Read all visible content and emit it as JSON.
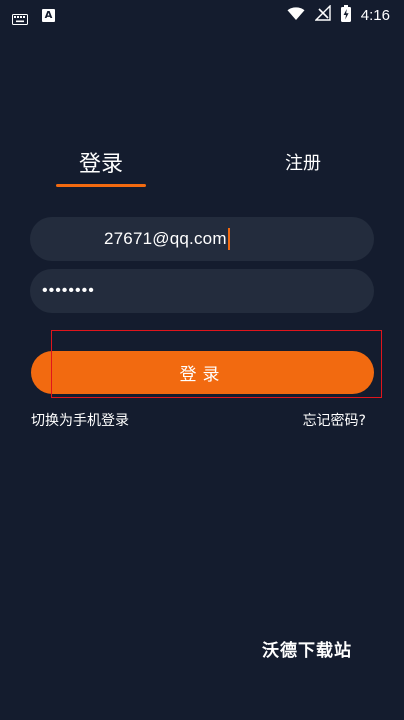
{
  "status_bar": {
    "time": "4:16",
    "left_icons": [
      "keyboard-icon",
      "a-icon"
    ],
    "a_letter": "A",
    "right_icons": [
      "wifi-icon",
      "no-signal-icon",
      "battery-charging-icon"
    ]
  },
  "tabs": {
    "login_label": "登录",
    "register_label": "注册",
    "active": "login"
  },
  "form": {
    "email_value": "27671@qq.com",
    "password_masked": "••••••••",
    "login_button_label": "登录",
    "switch_link": "切换为手机登录",
    "forgot_link": "忘记密码?"
  },
  "watermark": "沃德下载站",
  "colors": {
    "background": "#141c2e",
    "field_bg": "#232c3d",
    "accent": "#f26a10",
    "highlight": "#e0151c"
  }
}
